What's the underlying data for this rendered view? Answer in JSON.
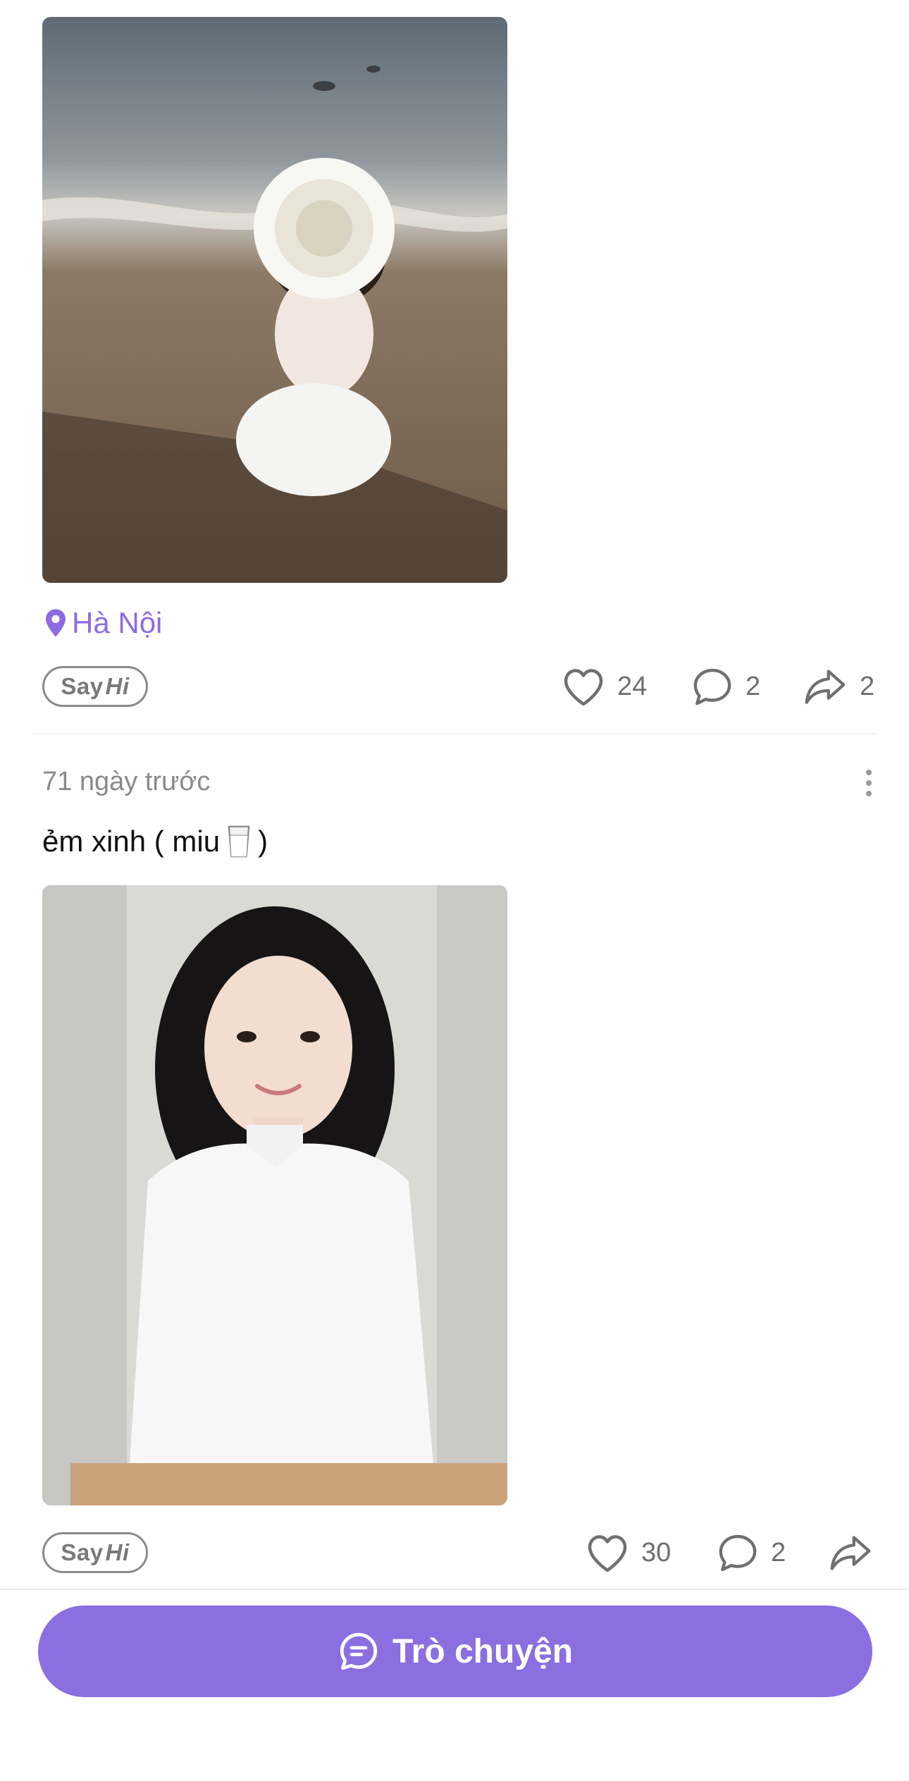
{
  "colors": {
    "accent": "#8d6be3",
    "button_bg": "#8b6fe0",
    "text_primary": "#111111",
    "text_secondary": "#8a8a8a",
    "icon_gray": "#6f6f6f"
  },
  "post1": {
    "location": "Hà Nội",
    "location_icon": "map-pin-icon",
    "say_hi": {
      "say": "Say",
      "hi": "Hi"
    },
    "likes": "24",
    "comments": "2",
    "shares": "2"
  },
  "post2": {
    "time_ago": "71 ngày trước",
    "caption_start": "ẻm xinh ( miu",
    "caption_end": ")",
    "caption_emoji_icon": "milk-glass-icon",
    "say_hi": {
      "say": "Say",
      "hi": "Hi"
    },
    "likes": "30",
    "comments": "2"
  },
  "bottom": {
    "chat_label": "Trò chuyện",
    "chat_icon": "chat-bubble-icon"
  }
}
